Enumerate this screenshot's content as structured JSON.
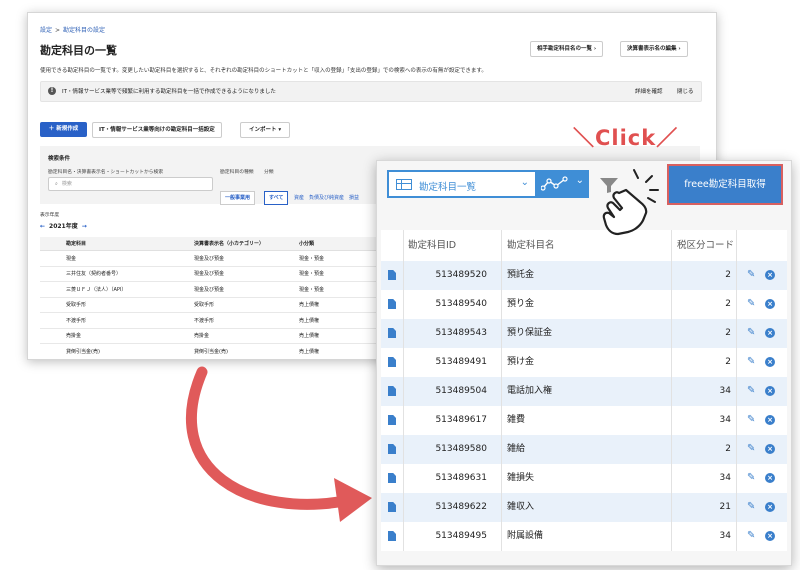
{
  "back": {
    "breadcrumb": [
      "設定",
      "勘定科目の設定"
    ],
    "title": "勘定科目の一覧",
    "header_buttons": [
      "相手勘定科目名の一覧 ›",
      "決算書表示名の編集 ›"
    ],
    "description": "使用できる勘定科目の一覧です。変更したい勘定科目を選択すると、それぞれの勘定科目のショートカットと「収入の登録」「支出の登録」での検索への表示の有無が設定できます。",
    "info_text": "IT・情報サービス業等で頻繁に利用する勘定科目を一括で作成できるようになりました",
    "info_link": "詳細を確認",
    "info_close": "閉じる",
    "new_button": "＋ 新規作成",
    "bulk_button": "IT・情報サービス業等向けの勘定科目一括設定",
    "import_button": "インポート ▾",
    "search": {
      "title": "検索条件",
      "field_label": "勘定科目名・決算書表示名・ショートカットから検索",
      "placeholder": "検索",
      "type_label": "勘定科目の種類",
      "type_value": "一般事業用",
      "class_label": "分類",
      "class_all": "すべて",
      "class_items": "資産　負債及び純資産　損益"
    },
    "year_label": "表示年度",
    "year_value": "2021年度",
    "year_prev": "←",
    "year_next": "→",
    "table": {
      "headers": [
        "勘定科目",
        "決算書表示名（小カテゴリー）",
        "小分類"
      ],
      "rows": [
        [
          "現金",
          "現金及び預金",
          "現金・預金"
        ],
        [
          "三井住友（契約者番号）",
          "現金及び預金",
          "現金・預金"
        ],
        [
          "三菱ＵＦＪ（法人）（API）",
          "現金及び預金",
          "現金・預金"
        ],
        [
          "受取手形",
          "受取手形",
          "売上債権"
        ],
        [
          "不渡手形",
          "不渡手形",
          "売上債権"
        ],
        [
          "売掛金",
          "売掛金",
          "売上債権"
        ],
        [
          "貸倒引当金(売)",
          "貸倒引当金(売)",
          "売上債権"
        ]
      ]
    }
  },
  "front": {
    "view_label": "勘定科目一覧",
    "freee_button": "freee勘定科目取得",
    "table": {
      "headers": [
        "勘定科目ID",
        "勘定科目名",
        "税区分コード"
      ],
      "rows": [
        {
          "id": "513489520",
          "name": "預託金",
          "tax": "2"
        },
        {
          "id": "513489540",
          "name": "預り金",
          "tax": "2"
        },
        {
          "id": "513489543",
          "name": "預り保証金",
          "tax": "2"
        },
        {
          "id": "513489491",
          "name": "預け金",
          "tax": "2"
        },
        {
          "id": "513489504",
          "name": "電話加入権",
          "tax": "34"
        },
        {
          "id": "513489617",
          "name": "雑費",
          "tax": "34"
        },
        {
          "id": "513489580",
          "name": "雑給",
          "tax": "2"
        },
        {
          "id": "513489631",
          "name": "雑損失",
          "tax": "34"
        },
        {
          "id": "513489622",
          "name": "雑収入",
          "tax": "21"
        },
        {
          "id": "513489495",
          "name": "附属設備",
          "tax": "34"
        }
      ]
    }
  },
  "overlay": {
    "click_label": "＼Click／",
    "accent_color": "#e05050",
    "primary_color": "#3a7fcb"
  }
}
